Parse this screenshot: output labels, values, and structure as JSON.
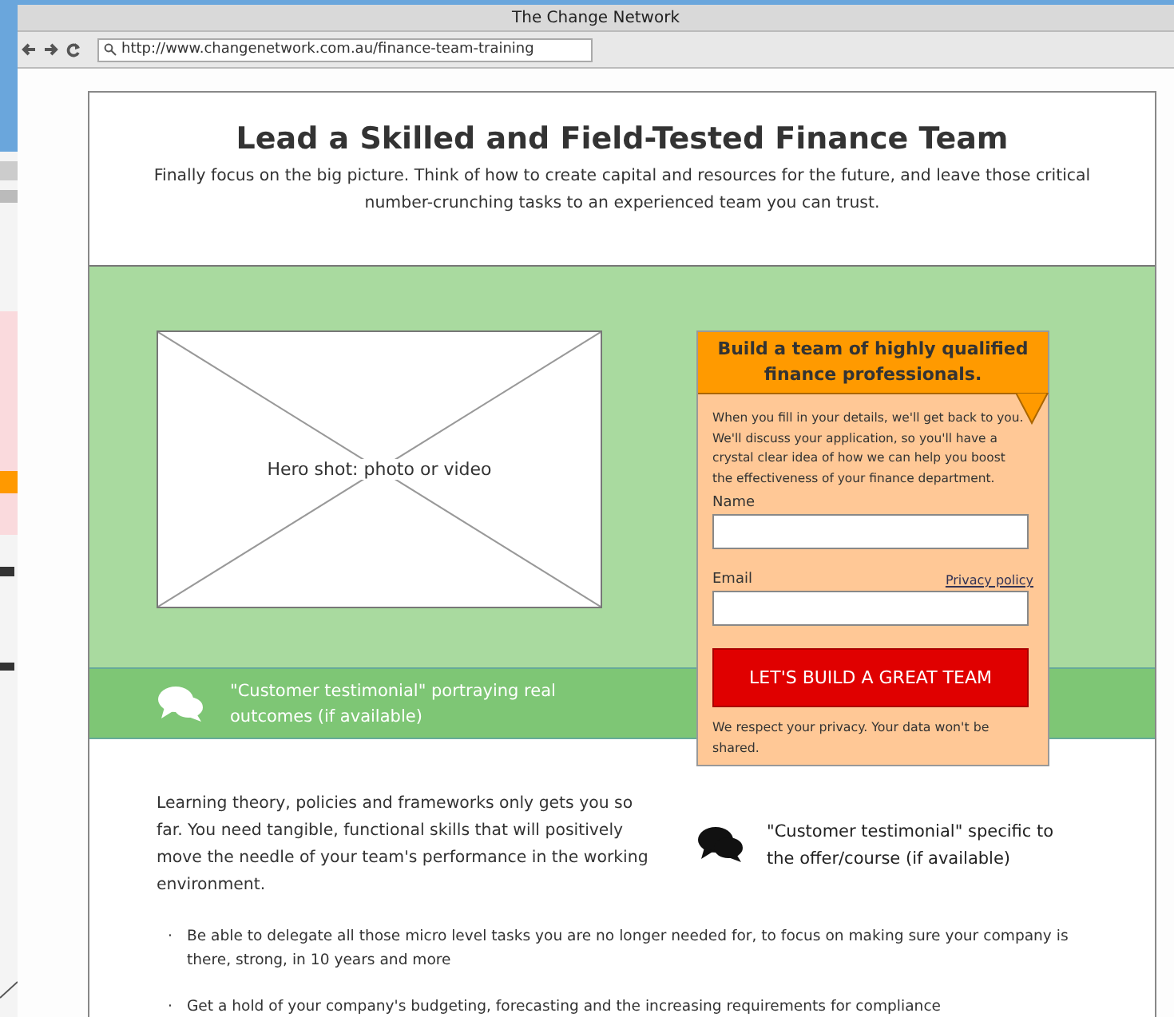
{
  "window": {
    "title": "The Change Network"
  },
  "address_bar": {
    "url": "http://www.changenetwork.com.au/finance-team-training"
  },
  "header": {
    "title": "Lead a Skilled and Field-Tested Finance Team",
    "subtitle": "Finally focus on the big picture. Think of how to create capital and resources for the future, and leave those critical number-crunching tasks to an experienced team you can trust."
  },
  "hero": {
    "label": "Hero shot: photo or video"
  },
  "testimonial_bar": {
    "text": "\"Customer testimonial\" portraying real outcomes (if available)"
  },
  "form": {
    "title": "Build a team of highly qualified finance professionals.",
    "intro": "When you fill in your details, we'll get back to you. We'll discuss your application, so you'll have a crystal clear idea of how we can help you boost the effectiveness of your finance department.",
    "fields": [
      {
        "label": "Name"
      },
      {
        "label": "Email",
        "link": "Privacy policy"
      }
    ],
    "button": "LET'S BUILD A GREAT TEAM",
    "note": "We respect your privacy. Your data won't be shared."
  },
  "body": {
    "paragraph": "Learning theory, policies and frameworks only gets you so far. You need tangible, functional skills that will positively move the needle of your team's performance in the working environment.",
    "testimonial": "\"Customer testimonial\" specific to the offer/course (if available)",
    "marker": "·",
    "bullets": [
      "Be able to delegate all those micro level tasks you are no longer needed for, to focus on making sure your company is there, strong, in 10 years and more",
      "Get a hold of your company's budgeting, forecasting and the increasing requirements for compliance"
    ]
  }
}
